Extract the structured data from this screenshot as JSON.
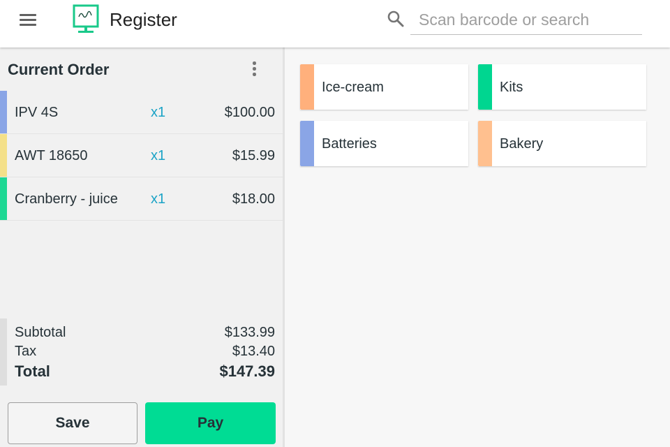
{
  "header": {
    "title": "Register",
    "search_placeholder": "Scan barcode or search",
    "search_value": ""
  },
  "order": {
    "title": "Current Order",
    "items": [
      {
        "name": "IPV 4S",
        "qty": "x1",
        "price": "$100.00",
        "color": "#8aa5e6"
      },
      {
        "name": "AWT 18650",
        "qty": "x1",
        "price": "$15.99",
        "color": "#f4e089"
      },
      {
        "name": "Cranberry - juice",
        "qty": "x1",
        "price": "$18.00",
        "color": "#1ed894"
      }
    ],
    "totals": {
      "subtotal_label": "Subtotal",
      "subtotal": "$133.99",
      "tax_label": "Tax",
      "tax": "$13.40",
      "total_label": "Total",
      "total": "$147.39"
    },
    "save_label": "Save",
    "pay_label": "Pay"
  },
  "categories": [
    {
      "name": "Ice-cream",
      "color": "#ffb07c"
    },
    {
      "name": "Kits",
      "color": "#00d690"
    },
    {
      "name": "Batteries",
      "color": "#8aa5e6"
    },
    {
      "name": "Bakery",
      "color": "#ffc08f"
    }
  ],
  "colors": {
    "accent": "#00dc94",
    "qty": "#1ba3c6"
  },
  "icons": {
    "menu": "menu-icon",
    "logo": "register-logo-icon",
    "search": "search-icon",
    "more": "more-vert-icon"
  }
}
